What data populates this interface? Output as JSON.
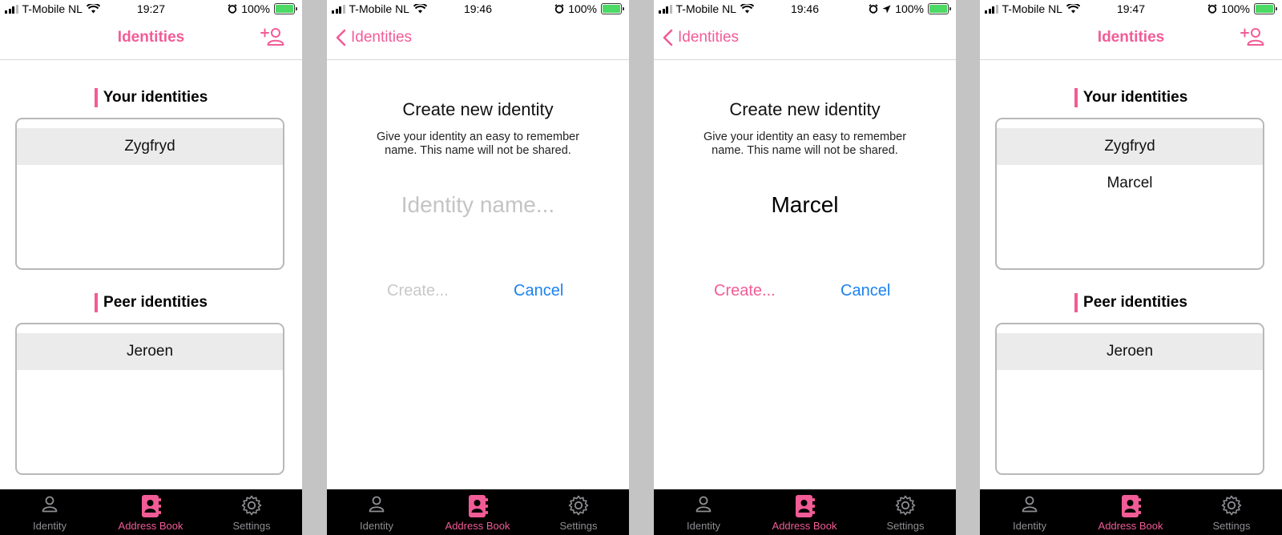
{
  "colors": {
    "accent": "#f25c96",
    "link_blue": "#1a82f0",
    "tabbar_bg": "#000000",
    "inactive_tab": "#8e8e93",
    "battery": "#4cd964"
  },
  "screens": [
    {
      "status": {
        "carrier": "T-Mobile NL",
        "time": "19:27",
        "battery": "100%"
      },
      "nav": {
        "title": "Identities"
      },
      "your_title": "Your identities",
      "your_items": [
        "Zygfryd"
      ],
      "peer_title": "Peer identities",
      "peer_items": [
        "Jeroen"
      ]
    },
    {
      "status": {
        "carrier": "T-Mobile NL",
        "time": "19:46",
        "battery": "100%"
      },
      "nav": {
        "back_label": "Identities"
      },
      "dialog": {
        "title": "Create new identity",
        "desc": "Give your identity an easy to remember name. This name will not be shared.",
        "input_value": "",
        "input_placeholder": "Identity name...",
        "create_label": "Create...",
        "cancel_label": "Cancel"
      }
    },
    {
      "status": {
        "carrier": "T-Mobile NL",
        "time": "19:46",
        "battery": "100%"
      },
      "nav": {
        "back_label": "Identities"
      },
      "dialog": {
        "title": "Create new identity",
        "desc": "Give your identity an easy to remember name. This name will not be shared.",
        "input_value": "Marcel",
        "input_placeholder": "Identity name...",
        "create_label": "Create...",
        "cancel_label": "Cancel"
      }
    },
    {
      "status": {
        "carrier": "T-Mobile NL",
        "time": "19:47",
        "battery": "100%"
      },
      "nav": {
        "title": "Identities"
      },
      "your_title": "Your identities",
      "your_items": [
        "Zygfryd",
        "Marcel"
      ],
      "peer_title": "Peer identities",
      "peer_items": [
        "Jeroen"
      ]
    }
  ],
  "tabs": [
    {
      "label": "Identity",
      "icon": "person-icon"
    },
    {
      "label": "Address Book",
      "icon": "address-book-icon",
      "active": true
    },
    {
      "label": "Settings",
      "icon": "gear-icon"
    }
  ]
}
